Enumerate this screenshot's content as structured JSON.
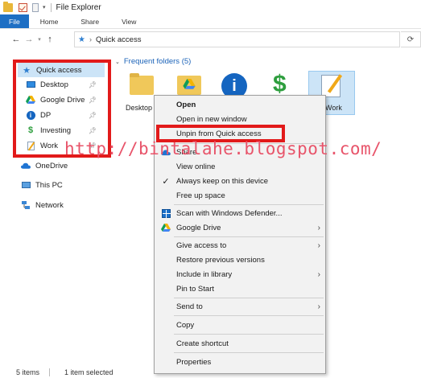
{
  "window": {
    "title": "File Explorer"
  },
  "ribbon": {
    "tabs": [
      "File",
      "Home",
      "Share",
      "View"
    ]
  },
  "address": {
    "crumb": "Quick access"
  },
  "sidebar": {
    "quick_access": "Quick access",
    "pinned": [
      {
        "label": "Desktop",
        "icon": "desktop-icon"
      },
      {
        "label": "Google Drive",
        "icon": "google-drive-icon"
      },
      {
        "label": "DP",
        "icon": "info-icon"
      },
      {
        "label": "Investing",
        "icon": "dollar-icon"
      },
      {
        "label": "Work",
        "icon": "document-icon"
      }
    ],
    "onedrive": "OneDrive",
    "this_pc": "This PC",
    "network": "Network"
  },
  "content": {
    "section_header": "Frequent folders (5)",
    "tiles": [
      "Desktop",
      "Work"
    ]
  },
  "context_menu": {
    "items": [
      {
        "label": "Open",
        "bold": true
      },
      {
        "label": "Open in new window"
      },
      {
        "label": "Unpin from Quick access"
      },
      {
        "label": "Share",
        "icon": "onedrive-cloud-icon"
      },
      {
        "label": "View online"
      },
      {
        "label": "Always keep on this device",
        "checked": true
      },
      {
        "label": "Free up space"
      },
      {
        "label": "Scan with Windows Defender...",
        "icon": "windows-defender-icon"
      },
      {
        "label": "Google Drive",
        "icon": "google-drive-icon",
        "submenu": true
      },
      {
        "label": "Give access to",
        "submenu": true
      },
      {
        "label": "Restore previous versions"
      },
      {
        "label": "Include in library",
        "submenu": true
      },
      {
        "label": "Pin to Start"
      },
      {
        "label": "Send to",
        "submenu": true
      },
      {
        "label": "Copy"
      },
      {
        "label": "Create shortcut"
      },
      {
        "label": "Properties"
      }
    ]
  },
  "watermark": "http://bintalahe.blogspot.com/",
  "status": {
    "items_count": "5 items",
    "selected": "1 item selected"
  },
  "colors": {
    "accent": "#1e6fc4",
    "selection": "#cce4f7",
    "highlight_box": "#e21a1a",
    "watermark": "#e8546a"
  }
}
